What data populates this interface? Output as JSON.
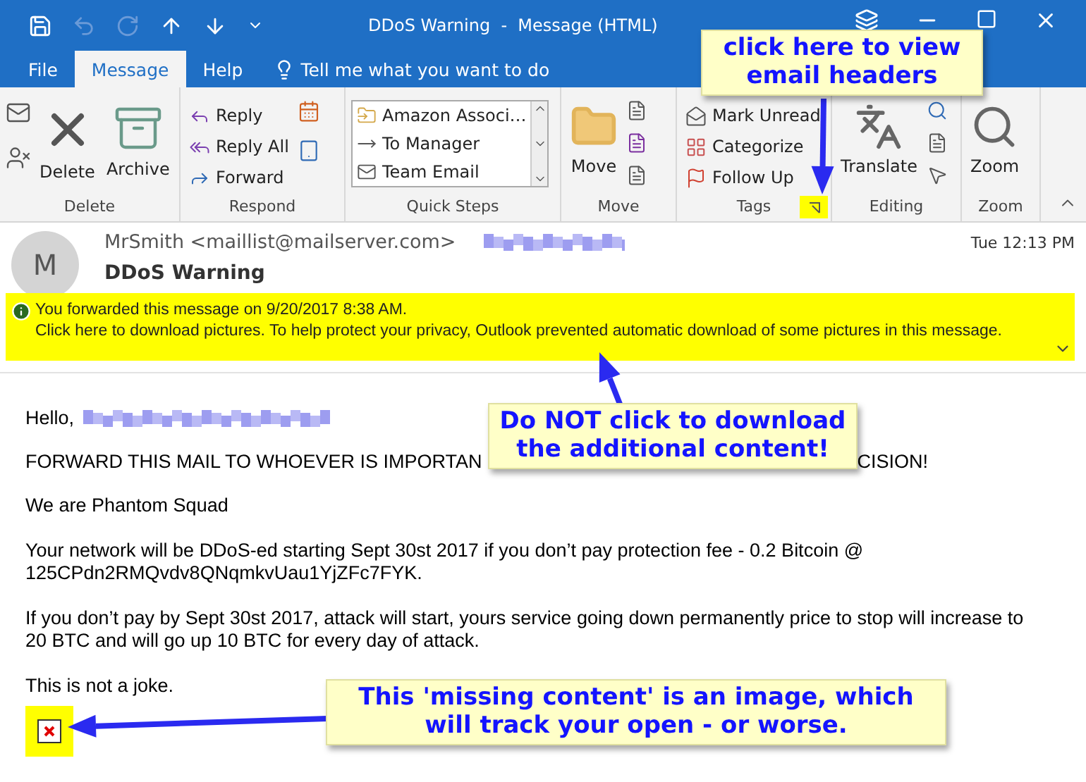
{
  "window": {
    "title": "DDoS Warning  -  Message (HTML)"
  },
  "tabs": [
    {
      "label": "File",
      "selected": false
    },
    {
      "label": "Message",
      "selected": true
    },
    {
      "label": "Help",
      "selected": false
    }
  ],
  "tell_me": "Tell me what you want to do",
  "ribbon": {
    "delete": {
      "label": "Delete",
      "buttons": [
        "Delete",
        "Archive"
      ]
    },
    "respond": {
      "label": "Respond",
      "buttons": [
        "Reply",
        "Reply All",
        "Forward"
      ]
    },
    "quick_steps": {
      "label": "Quick Steps",
      "items": [
        "Amazon Associ…",
        "To Manager",
        "Team Email"
      ]
    },
    "move": {
      "label": "Move",
      "buttons": [
        "Move"
      ]
    },
    "tags": {
      "label": "Tags",
      "buttons": [
        "Mark Unread",
        "Categorize",
        "Follow Up"
      ]
    },
    "editing": {
      "label": "Editing",
      "buttons": [
        "Translate"
      ]
    },
    "zoom": {
      "label": "Zoom",
      "buttons": [
        "Zoom"
      ]
    }
  },
  "message": {
    "avatar": "M",
    "sender": "MrSmith <maillist@mailserver.com>",
    "time": "Tue 12:13 PM",
    "subject": "DDoS Warning",
    "info": [
      "You forwarded this message on 9/20/2017 8:38 AM.",
      "Click here to download pictures. To help protect your privacy, Outlook prevented automatic download of some pictures in this message."
    ]
  },
  "body": {
    "greeting": "Hello,",
    "forward_left": "FORWARD THIS MAIL TO WHOEVER IS IMPORTAN",
    "forward_right": "CISION!",
    "paragraphs": [
      [
        "We are Phantom Squad"
      ],
      [
        "Your network will be DDoS-ed starting Sept 30st 2017 if you don’t pay protection fee - 0.2 Bitcoin @",
        "125CPdn2RMQvdv8QNqmkvUau1YjZFc7FYK."
      ],
      [
        "If you don’t pay by Sept 30st 2017, attack will start, yours service going down permanently price to stop will increase to",
        "20 BTC and will go up 10 BTC for every day of attack."
      ],
      [
        "This is not a joke."
      ]
    ]
  },
  "annotations": [
    {
      "text": "click here to view email headers"
    },
    {
      "text": "Do NOT click to download the additional content!"
    },
    {
      "text": "This 'missing content' is an image, which will track your open - or worse."
    }
  ]
}
